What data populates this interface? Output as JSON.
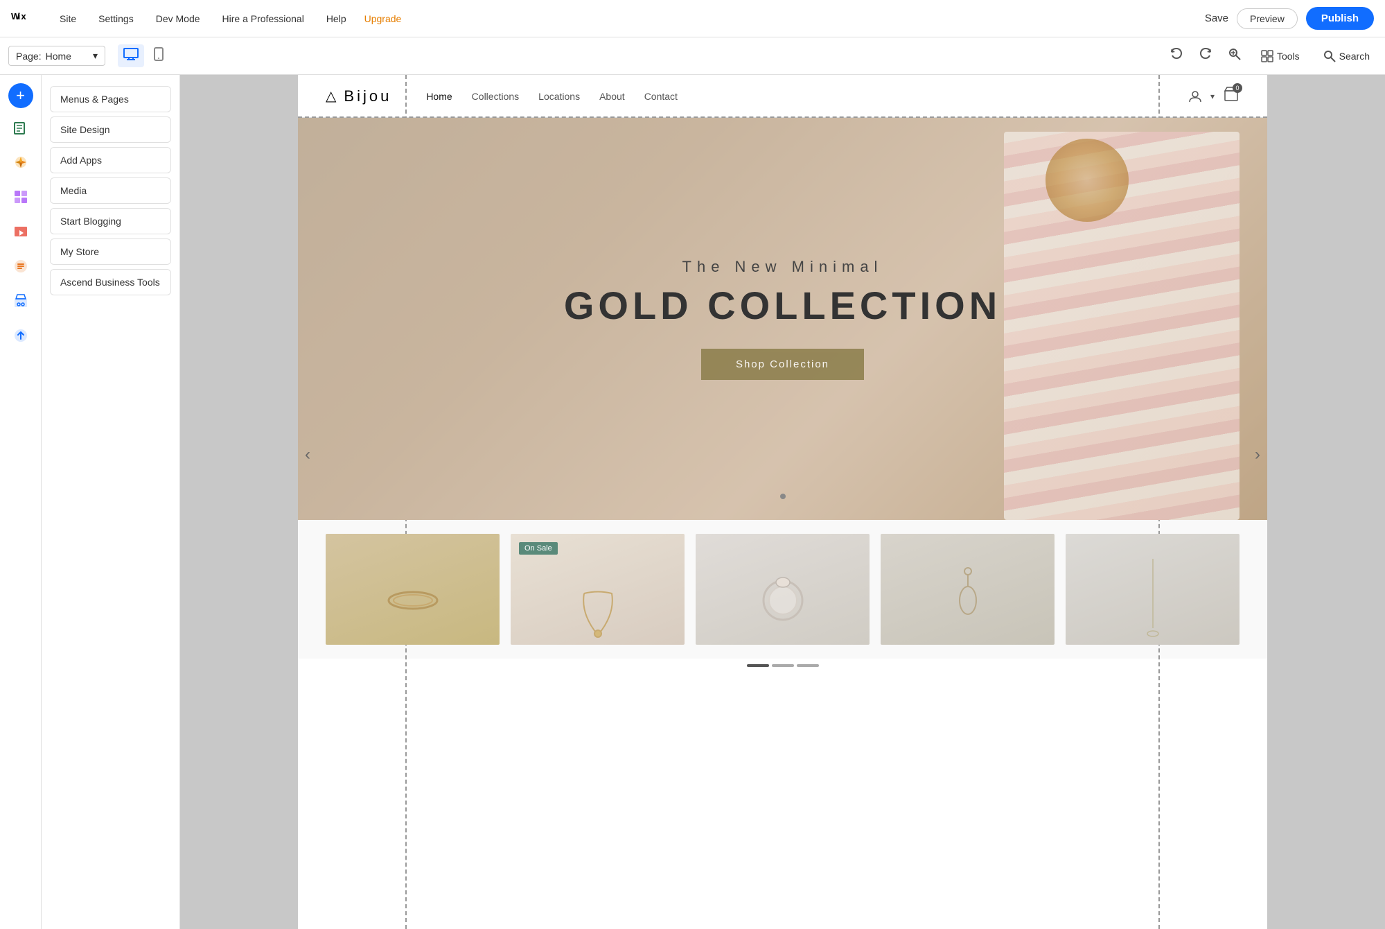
{
  "topbar": {
    "wix_logo": "wix",
    "nav_items": [
      {
        "label": "Site",
        "id": "site"
      },
      {
        "label": "Settings",
        "id": "settings"
      },
      {
        "label": "Dev Mode",
        "id": "dev-mode"
      },
      {
        "label": "Hire a Professional",
        "id": "hire"
      },
      {
        "label": "Help",
        "id": "help"
      },
      {
        "label": "Upgrade",
        "id": "upgrade"
      }
    ],
    "save_label": "Save",
    "preview_label": "Preview",
    "publish_label": "Publish"
  },
  "secondbar": {
    "page_label": "Page:",
    "page_name": "Home",
    "tools_label": "Tools",
    "search_label": "Search"
  },
  "sidebar": {
    "add_label": "+",
    "icons": [
      {
        "id": "add",
        "symbol": "+",
        "active": true
      },
      {
        "id": "pages",
        "symbol": "☰"
      },
      {
        "id": "design",
        "symbol": "✦"
      },
      {
        "id": "apps",
        "symbol": "⊞"
      },
      {
        "id": "media",
        "symbol": "▣"
      },
      {
        "id": "blog",
        "symbol": "✎"
      },
      {
        "id": "store",
        "symbol": "🛍"
      },
      {
        "id": "ascend",
        "symbol": "⬆"
      }
    ],
    "menu_items": [
      {
        "label": "Menus & Pages",
        "id": "menus-pages"
      },
      {
        "label": "Site Design",
        "id": "site-design"
      },
      {
        "label": "Add Apps",
        "id": "add-apps"
      },
      {
        "label": "Media",
        "id": "media"
      },
      {
        "label": "Start Blogging",
        "id": "start-blogging"
      },
      {
        "label": "My Store",
        "id": "my-store"
      },
      {
        "label": "Ascend Business Tools",
        "id": "ascend-tools"
      }
    ]
  },
  "preview": {
    "nav": {
      "logo_icon": "△",
      "logo_text": "Bijou",
      "links": [
        {
          "label": "Home",
          "active": true
        },
        {
          "label": "Collections"
        },
        {
          "label": "Locations"
        },
        {
          "label": "About"
        },
        {
          "label": "Contact"
        }
      ]
    },
    "hero": {
      "subtitle": "The New Minimal",
      "title": "GOLD COLLECTION",
      "cta_label": "Shop Collection"
    },
    "products": {
      "on_sale_label": "On Sale",
      "arrow_left": "‹",
      "arrow_right": "›"
    }
  },
  "colors": {
    "accent_blue": "#116dff",
    "upgrade_orange": "#e67e00",
    "publish_blue": "#116dff",
    "hero_cta": "#8b7d4a",
    "on_sale_green": "#5a8a7a"
  }
}
